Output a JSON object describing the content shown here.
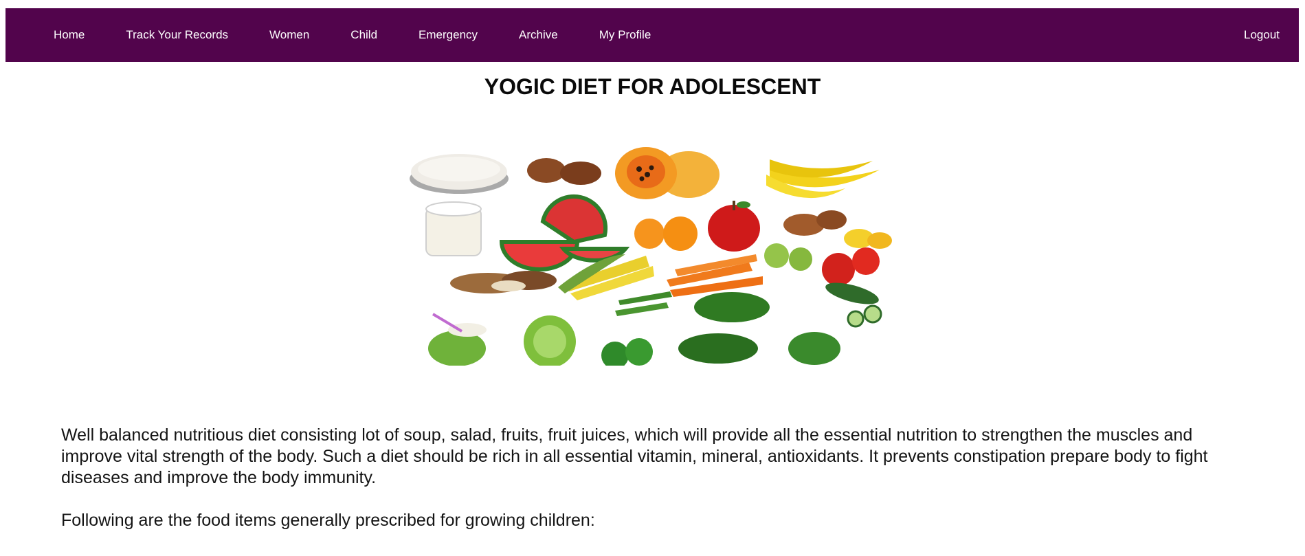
{
  "nav": {
    "items": [
      {
        "label": "Home"
      },
      {
        "label": "Track Your Records"
      },
      {
        "label": "Women"
      },
      {
        "label": "Child"
      },
      {
        "label": "Emergency"
      },
      {
        "label": "Archive"
      },
      {
        "label": "My Profile"
      }
    ],
    "logout_label": "Logout",
    "background_color": "#52044c"
  },
  "page": {
    "title": "YOGIC DIET FOR ADOLESCENT",
    "image_icon": "assorted-healthy-foods-image",
    "paragraphs": [
      "Well balanced nutritious diet consisting lot of soup, salad, fruits, fruit juices, which will provide all the essential nutrition to strengthen the muscles and improve vital strength of the body. Such a diet should be rich in all essential vitamin, mineral, antioxidants. It prevents constipation prepare body to fight diseases and improve the body immunity.",
      "Following are the food items generally prescribed for growing children:"
    ]
  }
}
